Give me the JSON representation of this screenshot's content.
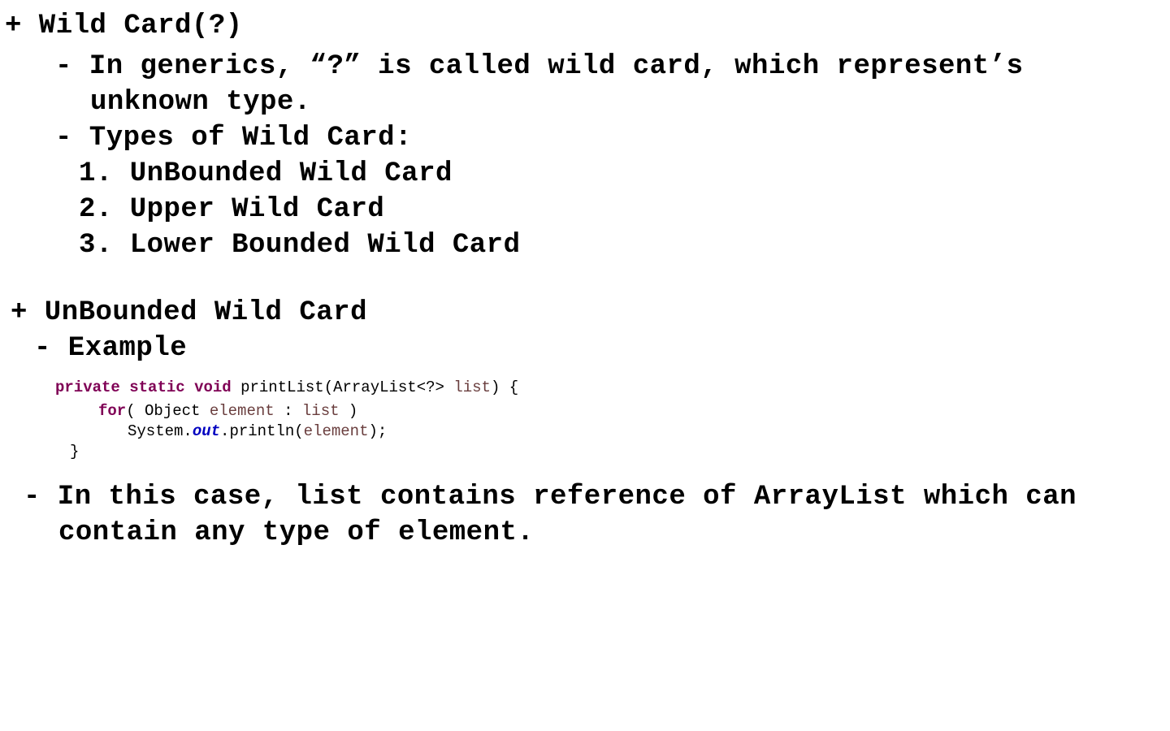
{
  "section1": {
    "heading": "+ Wild Card(?)",
    "bullet1_line1": "- In generics, “?” is called wild card, which represent’s",
    "bullet1_line2": "unknown type.",
    "bullet2": "- Types of Wild Card:",
    "types": [
      "1. UnBounded Wild Card",
      "2. Upper Wild Card",
      "3. Lower Bounded Wild Card"
    ]
  },
  "section2": {
    "heading": "+ UnBounded Wild Card",
    "example_label": "- Example",
    "code": {
      "line1": {
        "kw1": "private",
        "kw2": "static",
        "kw3": "void",
        "sig": "printList(ArrayList<?>",
        "param": "list",
        "end": ") {"
      },
      "line2": {
        "kw": "for",
        "open": "( Object",
        "var1": "element",
        "colon": ":",
        "var2": "list",
        "close": ")"
      },
      "line3": {
        "prefix": "System.",
        "field": "out",
        "mid": ".println(",
        "var": "element",
        "end": ");"
      },
      "line4": "}"
    },
    "note_line1": "- In this case, list contains reference of ArrayList which can",
    "note_line2": "contain any type of element."
  },
  "colors": {
    "keyword": "#7f0055",
    "variable": "#6a3e3e",
    "static_field": "#0000c0",
    "text": "#000000",
    "background": "#ffffff"
  }
}
